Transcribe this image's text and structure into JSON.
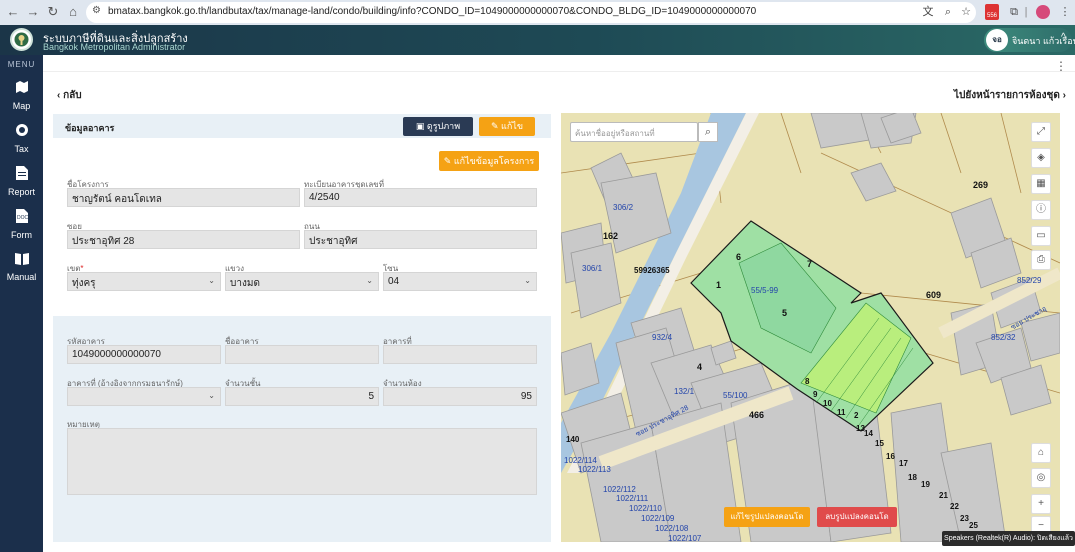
{
  "browser": {
    "url": "bmatax.bangkok.go.th/landbutax/tax/manage-land/condo/building/info?CONDO_ID=1049000000000070&CONDO_BLDG_ID=1049000000000070",
    "badge": "556"
  },
  "header": {
    "title": "ระบบภาษีที่ดินและสิ่งปลูกสร้าง",
    "subtitle": "Bangkok Metropolitan Administrator",
    "user_initials": "จอ",
    "user_name": "จินดนา แก้วเรือน"
  },
  "sidebar": {
    "menu_label": "MENU",
    "items": [
      {
        "label": "Map",
        "icon": "map-icon"
      },
      {
        "label": "Tax",
        "icon": "tax-icon"
      },
      {
        "label": "Report",
        "icon": "report-icon"
      },
      {
        "label": "Form",
        "icon": "form-icon"
      },
      {
        "label": "Manual",
        "icon": "manual-icon"
      }
    ]
  },
  "nav": {
    "back": "กลับ",
    "goto_rooms": "ไปยังหน้ารายการห้องชุด"
  },
  "panel": {
    "title": "ข้อมูลอาคาร",
    "btn_image": "ดูรูปภาพ",
    "btn_edit": "แก้ไข",
    "btn_edit_project": "แก้ไขข้อมูลโครงการ"
  },
  "form": {
    "project_name_label": "ชื่อโครงการ",
    "project_name": "ชาญรัตน์ คอนโดเทล",
    "condo_reg_label": "ทะเบียนอาคารชุดเลขที่",
    "condo_reg": "4/2540",
    "soi_label": "ซอย",
    "soi": "ประชาอุทิศ 28",
    "road_label": "ถนน",
    "road": "ประชาอุทิศ",
    "district_label": "เขต",
    "required_mark": "*",
    "district": "ทุ่งครุ",
    "subdistrict_label": "แขวง",
    "subdistrict": "บางมด",
    "zone_label": "โซน",
    "zone": "04",
    "building_code_label": "รหัสอาคาร",
    "building_code": "1049000000000070",
    "building_name_label": "ชื่ออาคาร",
    "building_name": "",
    "building_no_label": "อาคารที่",
    "building_no": "",
    "building_ref_label": "อาคารที่ (อ้างอิงจากกรมธนารักษ์)",
    "building_ref": "",
    "floors_label": "จำนวนชั้น",
    "floors": "5",
    "rooms_label": "จำนวนห้อง",
    "rooms": "95",
    "remarks_label": "หมายเหตุ",
    "remarks": ""
  },
  "map": {
    "search_placeholder": "ค้นหาชื่ออยู่หรือสถานที่",
    "btn_edit_parcel": "แก้ไขรูปแปลงคอนโด",
    "btn_delete_parcel": "ลบรูปแปลงคอนโด",
    "labels": {
      "l269": "269",
      "l609": "609",
      "l162": "162",
      "l7": "7",
      "l6": "6",
      "l1": "1",
      "l5": "5",
      "l4": "4",
      "l466": "466",
      "l8": "8",
      "l9": "9",
      "l10": "10",
      "l11": "11",
      "l2": "2",
      "l13": "13",
      "l14": "14",
      "l15": "15",
      "l16": "16",
      "l17": "17",
      "l18": "18",
      "l19": "19",
      "l21": "21",
      "l22": "22",
      "l23": "23",
      "l25": "25",
      "l140": "140",
      "p59926365": "59926365",
      "p3062": "306/2",
      "p3061": "306/1",
      "p5559": "55/5-99",
      "p9324": "932/4",
      "p1321": "132/1",
      "p55100": "55/100",
      "p85229": "852/29",
      "p85232": "852/32",
      "p1022114": "1022/114",
      "p1022113": "1022/113",
      "p1022112": "1022/112",
      "p1022111": "1022/111",
      "p1022110": "1022/110",
      "p1022109": "1022/109",
      "p1022108": "1022/108",
      "p1022107": "1022/107",
      "road1": "ซอย ประชาอุทิศ 28",
      "road2": "ซอย ประชาอุ"
    }
  },
  "toast": "Speakers (Realtek(R) Audio): ปิดเสียงแล้ว"
}
